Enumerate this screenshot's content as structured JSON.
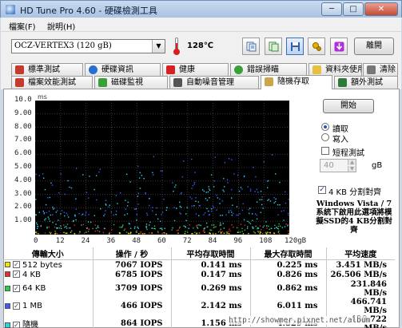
{
  "window": {
    "title": "HD Tune Pro 4.60 - 硬碟檢測工具",
    "min": "─",
    "max": "□",
    "close": "✕"
  },
  "menu": {
    "file": "檔案(F)",
    "help": "說明(H)"
  },
  "toolbar": {
    "drive": "OCZ-VERTEX3 (120 gB)",
    "temperature": "128℃",
    "exit_label": "離開",
    "icons": [
      "copy-text-icon",
      "copy-screen-icon",
      "save-icon",
      "options-icon",
      "download-icon"
    ]
  },
  "tabs": {
    "row1": [
      "標準測試",
      "硬碟資訊",
      "健康",
      "錯誤掃瞄",
      "資料夾使用率",
      "清除"
    ],
    "row2": [
      "檔案效能測試",
      "磁碟監視",
      "自動噪音管理",
      "隨機存取",
      "額外測試"
    ],
    "active": "隨機存取"
  },
  "side": {
    "start_label": "開始",
    "read_label": "讀取",
    "write_label": "寫入",
    "short_test_label": "短程測試",
    "size_value": "40",
    "size_unit": "gB",
    "align_label": "4 KB 分割對齊",
    "note": "Windows Vista / 7系統下啟用此選項將模擬SSD的4 KB分割對齊"
  },
  "chart_data": {
    "type": "scatter",
    "ylabel": "ms",
    "xlabel": "",
    "ylim": [
      0,
      10
    ],
    "xlim": [
      0,
      120
    ],
    "y_ticks": [
      "10.0",
      "9.00",
      "8.00",
      "7.00",
      "6.00",
      "5.00",
      "4.00",
      "3.00",
      "2.00",
      "1.00"
    ],
    "x_ticks": [
      "0",
      "12",
      "24",
      "36",
      "48",
      "60",
      "72",
      "84",
      "96",
      "108",
      "120gB"
    ],
    "grid": true,
    "series": [
      {
        "name": "512 bytes",
        "color": "#f2e600",
        "y_range": [
          0.1,
          0.23
        ]
      },
      {
        "name": "4 KB",
        "color": "#e53030",
        "y_range": [
          0.12,
          0.83
        ]
      },
      {
        "name": "64 KB",
        "color": "#2ecc40",
        "y_range": [
          0.2,
          0.86
        ]
      },
      {
        "name": "1 MB",
        "color": "#3a5bff",
        "y_range": [
          1.5,
          6.0
        ]
      },
      {
        "name": "隨機",
        "color": "#27d7e6",
        "y_range": [
          0.5,
          4.8
        ]
      }
    ]
  },
  "results": {
    "headers": [
      "傳輸大小",
      "操作 / 秒",
      "平均存取時間",
      "最大存取時間",
      "平均速度"
    ],
    "rows": [
      {
        "label": "512 bytes",
        "color": "#f2e600",
        "ops": "7067 IOPS",
        "avg": "0.141 ms",
        "max": "0.225 ms",
        "speed": "3.451 MB/s"
      },
      {
        "label": "4 KB",
        "color": "#e53030",
        "ops": "6785 IOPS",
        "avg": "0.147 ms",
        "max": "0.826 ms",
        "speed": "26.506 MB/s"
      },
      {
        "label": "64 KB",
        "color": "#2ecc40",
        "ops": "3709 IOPS",
        "avg": "0.269 ms",
        "max": "0.862 ms",
        "speed": "231.846 MB/s"
      },
      {
        "label": "1 MB",
        "color": "#3a5bff",
        "ops": "466 IOPS",
        "avg": "2.142 ms",
        "max": "6.011 ms",
        "speed": "466.741 MB/s"
      },
      {
        "label": "隨機",
        "color": "#27d7e6",
        "ops": "864 IOPS",
        "avg": "1.156 ms",
        "max": "4.829 ms",
        "speed": "438.722 MB/s"
      }
    ]
  },
  "watermark": "http://showmer.pixnet.net/album"
}
